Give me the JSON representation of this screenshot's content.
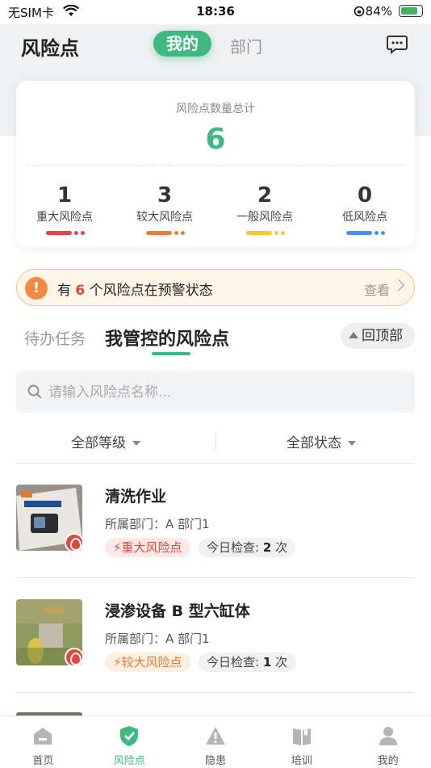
{
  "status_bar": {
    "carrier": "无SIM卡",
    "time": "18:36",
    "battery": "84%",
    "battery_level": 0.84
  },
  "header": {
    "title": "风险点",
    "tab_mine": "我的",
    "tab_dept": "部门"
  },
  "summary": {
    "label": "风险点数量总计",
    "total": "6",
    "levels": [
      {
        "count": "1",
        "label": "重大风险点",
        "color": "#e94343"
      },
      {
        "count": "3",
        "label": "较大风险点",
        "color": "#f07d2f"
      },
      {
        "count": "2",
        "label": "一般风险点",
        "color": "#f5c93b"
      },
      {
        "count": "0",
        "label": "低风险点",
        "color": "#4a8ef0"
      }
    ]
  },
  "alert": {
    "prefix": "有",
    "count": "6",
    "suffix": "个风险点在预警状态",
    "view": "查看"
  },
  "tabs": {
    "todo": "待办任务",
    "mine": "我管控的风险点",
    "back_top": "回顶部"
  },
  "search": {
    "placeholder": "请输入风险点名称..."
  },
  "filters": {
    "level": "全部等级",
    "status": "全部状态"
  },
  "items": [
    {
      "name": "清洗作业",
      "dept": "所属部门：A 部门1",
      "level": "重大风险点",
      "level_bg": "#fde9e8",
      "level_color": "#e0483d",
      "check_prefix": "今日检查:",
      "check_count": "2",
      "check_unit": "次"
    },
    {
      "name": "浸渗设备 B 型六缸体",
      "dept": "所属部门：A 部门1",
      "level": "较大风险点",
      "level_bg": "#fdf0e3",
      "level_color": "#ee7b2b",
      "check_prefix": "今日检查:",
      "check_count": "1",
      "check_unit": "次"
    }
  ],
  "nav": [
    {
      "label": "首页",
      "icon": "home-icon"
    },
    {
      "label": "风险点",
      "icon": "shield-check-icon"
    },
    {
      "label": "隐患",
      "icon": "warning-icon"
    },
    {
      "label": "培训",
      "icon": "book-icon"
    },
    {
      "label": "我的",
      "icon": "user-icon"
    }
  ]
}
